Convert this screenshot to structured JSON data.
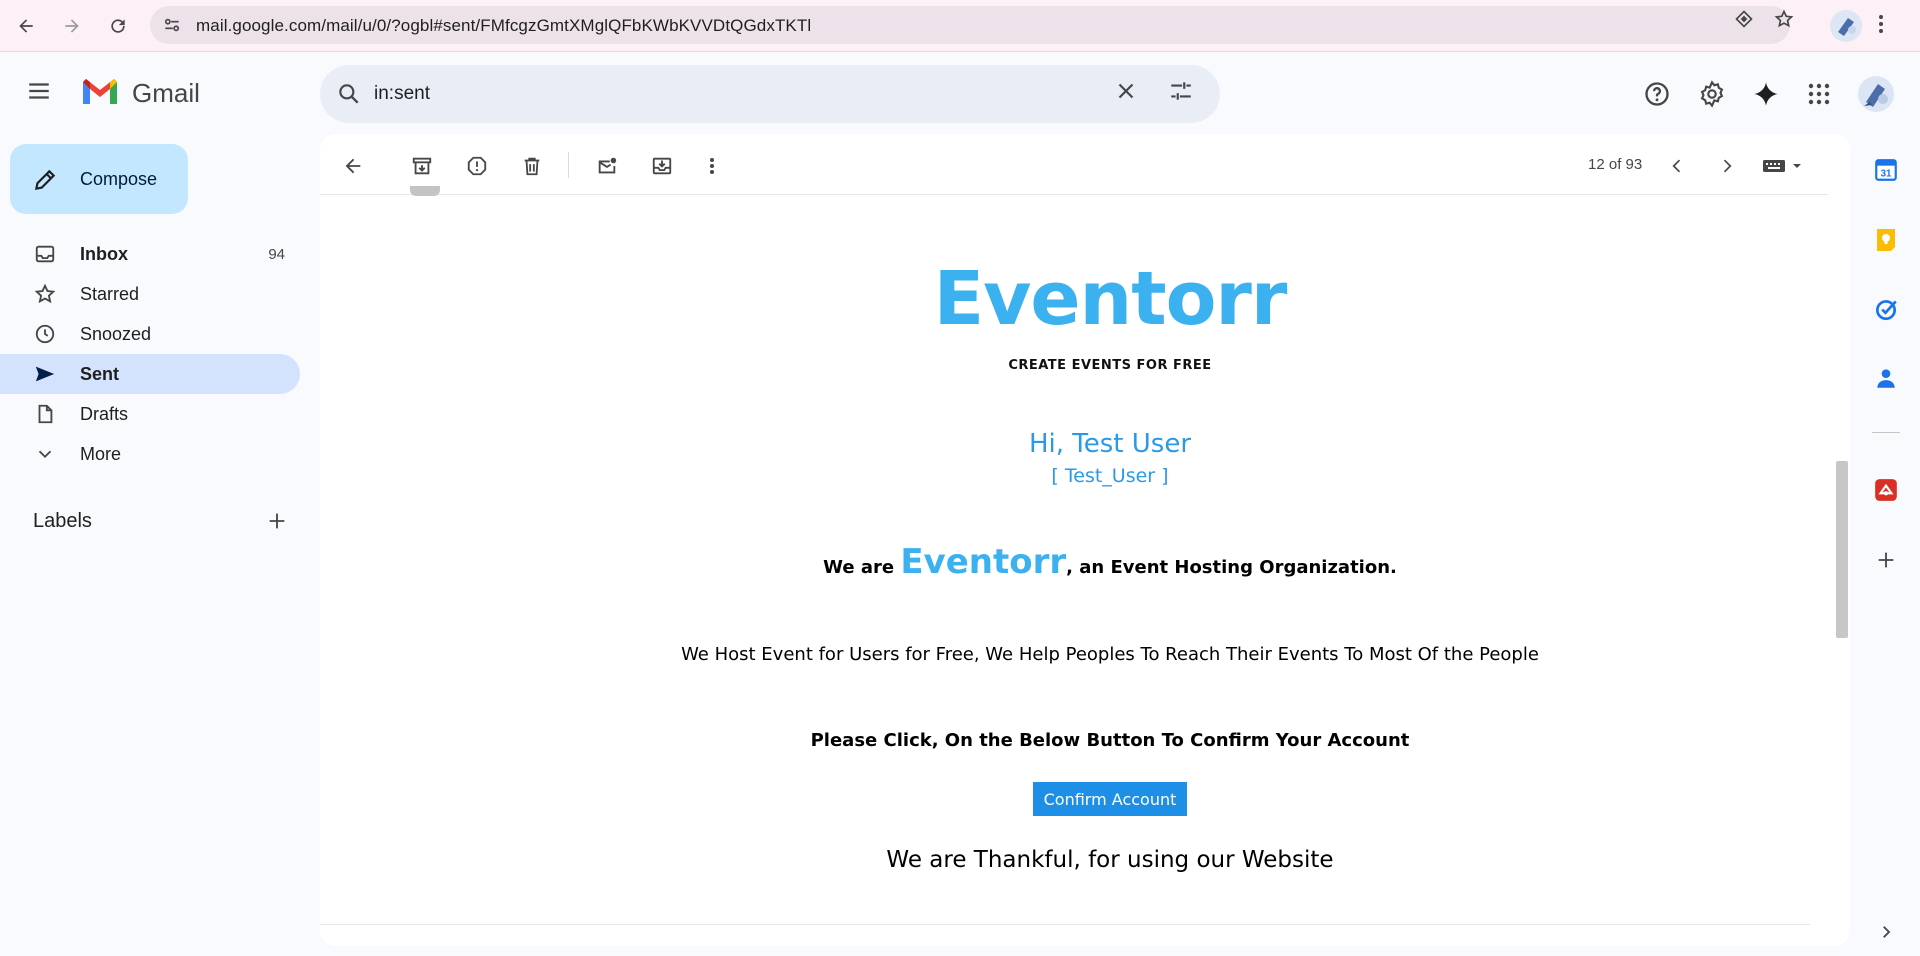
{
  "browser": {
    "url": "mail.google.com/mail/u/0/?ogbl#sent/FMfcgzGmtXMglQFbKWbKVVDtQGdxTKTl"
  },
  "app": {
    "name": "Gmail"
  },
  "search": {
    "query": "in:sent"
  },
  "compose": {
    "label": "Compose"
  },
  "nav": {
    "items": [
      {
        "label": "Inbox",
        "count": "94",
        "icon": "inbox-icon"
      },
      {
        "label": "Starred",
        "count": "",
        "icon": "star-icon"
      },
      {
        "label": "Snoozed",
        "count": "",
        "icon": "clock-icon"
      },
      {
        "label": "Sent",
        "count": "",
        "icon": "send-icon"
      },
      {
        "label": "Drafts",
        "count": "",
        "icon": "draft-icon"
      },
      {
        "label": "More",
        "count": "",
        "icon": "chevron-down-icon"
      }
    ],
    "active": "Sent"
  },
  "labels": {
    "title": "Labels"
  },
  "toolbar": {
    "pager": "12 of 93"
  },
  "email": {
    "brand": "Eventorr",
    "tagline": "CREATE EVENTS FOR FREE",
    "greeting": "Hi, Test User",
    "username": "[ Test_User ]",
    "intro_prefix": "We are ",
    "intro_brand": "Eventorr",
    "intro_suffix": ", an Event Hosting Organization.",
    "description": "We Host Event for Users for Free, We Help Peoples To Reach Their Events To Most Of the People",
    "cta_text": "Please Click, On the Below Button To Confirm Your Account",
    "confirm_button": "Confirm Account",
    "thanks": "We are Thankful, for using our Website"
  },
  "colors": {
    "accent": "#3cb1f0",
    "greeting": "#2a9ae8",
    "button": "#1e8fe6",
    "active_nav": "#d3e3fd",
    "compose_bg": "#c2e7ff"
  }
}
